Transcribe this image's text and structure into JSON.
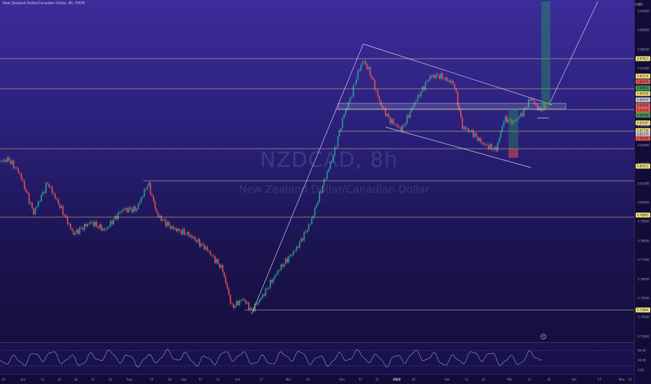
{
  "header": {
    "title": "New Zealand Dollar/Canadian Dollar, 8h, FXCM",
    "currency": "CAD"
  },
  "watermark": {
    "symbol": "NZDCAD, 8h",
    "name": "New Zealand Dollar/Canadian Dollar"
  },
  "price_axis": {
    "ticks": [
      "0.90000",
      "0.89000",
      "0.88000",
      "0.87000",
      "0.86000",
      "0.85000",
      "0.84000",
      "0.83000",
      "0.82000",
      "0.81000",
      "0.80000",
      "0.79000",
      "0.78000",
      "0.77000",
      "0.76000",
      "0.75000",
      "0.74000",
      "0.73000"
    ],
    "labels": [
      {
        "text": "0.87823",
        "color": "#f5e07a"
      },
      {
        "text": "0.85324",
        "color": "#f5e07a"
      },
      {
        "text": "0.85075",
        "color": "#e05a55"
      },
      {
        "text": "0.84682",
        "color": "#3a9a5c"
      },
      {
        "text": "0.84439",
        "color": "#f5e07a"
      },
      {
        "text": "0.84250",
        "color": "#c9c9dd"
      },
      {
        "text": "0.83549",
        "color": "#e05a55"
      },
      {
        "text": "0.83135",
        "color": "#e05a55"
      },
      {
        "text": "0.82958",
        "color": "#3a9a5c"
      },
      {
        "text": "0.82507",
        "color": "#f5e07a"
      },
      {
        "text": "0.81728",
        "color": "#f5e07a"
      },
      {
        "text": "0.81370",
        "color": "#c9c9dd"
      },
      {
        "text": "0.81060",
        "color": "#e05a55"
      },
      {
        "text": "0.80351",
        "color": "#f5e07a"
      },
      {
        "text": "0.78863",
        "color": "#f5e07a"
      },
      {
        "text": "0.73664",
        "color": "#f5e07a"
      }
    ]
  },
  "rsi_axis": {
    "ticks": [
      "80.00",
      "40.00",
      "0.00"
    ]
  },
  "time_axis": {
    "labels": [
      {
        "text": "23",
        "bold": false
      },
      {
        "text": "Jun",
        "bold": false
      },
      {
        "text": "13",
        "bold": false
      },
      {
        "text": "22",
        "bold": false
      },
      {
        "text": "Jul",
        "bold": false
      },
      {
        "text": "13",
        "bold": false
      },
      {
        "text": "22",
        "bold": false
      },
      {
        "text": "Aug",
        "bold": false
      },
      {
        "text": "15",
        "bold": false
      },
      {
        "text": "24",
        "bold": false
      },
      {
        "text": "Sep",
        "bold": false
      },
      {
        "text": "12",
        "bold": false
      },
      {
        "text": "21",
        "bold": false
      },
      {
        "text": "Oct",
        "bold": false
      },
      {
        "text": "17",
        "bold": false
      },
      {
        "text": "Nov",
        "bold": false
      },
      {
        "text": "14",
        "bold": false
      },
      {
        "text": "Dec",
        "bold": false
      },
      {
        "text": "12",
        "bold": false
      },
      {
        "text": "21",
        "bold": false
      },
      {
        "text": "2023",
        "bold": true
      },
      {
        "text": "16",
        "bold": false
      },
      {
        "text": "Feb",
        "bold": false
      },
      {
        "text": "13",
        "bold": false
      },
      {
        "text": "22",
        "bold": false
      },
      {
        "text": "Mar",
        "bold": false
      },
      {
        "text": "13",
        "bold": false
      },
      {
        "text": "22",
        "bold": false
      },
      {
        "text": "Apr",
        "bold": false
      },
      {
        "text": "17",
        "bold": false
      },
      {
        "text": "May",
        "bold": false
      },
      {
        "text": "15",
        "bold": false
      }
    ]
  },
  "colors": {
    "up": "#26a69a",
    "down": "#ef5350",
    "hline": "#f3e28a",
    "trend": "#d6d4ef",
    "rsi": "#9fa4d8"
  }
}
